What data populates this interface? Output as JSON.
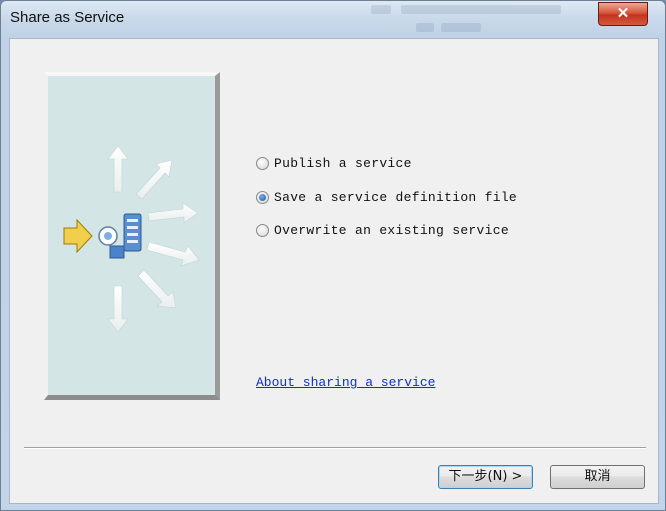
{
  "window": {
    "title": "Share as Service",
    "close_glyph": "✕"
  },
  "options": [
    {
      "label": "Publish a service",
      "checked": false
    },
    {
      "label": "Save a service definition file",
      "checked": true
    },
    {
      "label": "Overwrite an existing service",
      "checked": false
    }
  ],
  "link": {
    "label": "About sharing a service"
  },
  "buttons": {
    "next": "下一步(N) >",
    "cancel": "取消"
  },
  "illustration": {
    "icon": "service-publish-icon",
    "arrow_color": "#e9c13a",
    "panel_color": "#d4e5e5"
  }
}
